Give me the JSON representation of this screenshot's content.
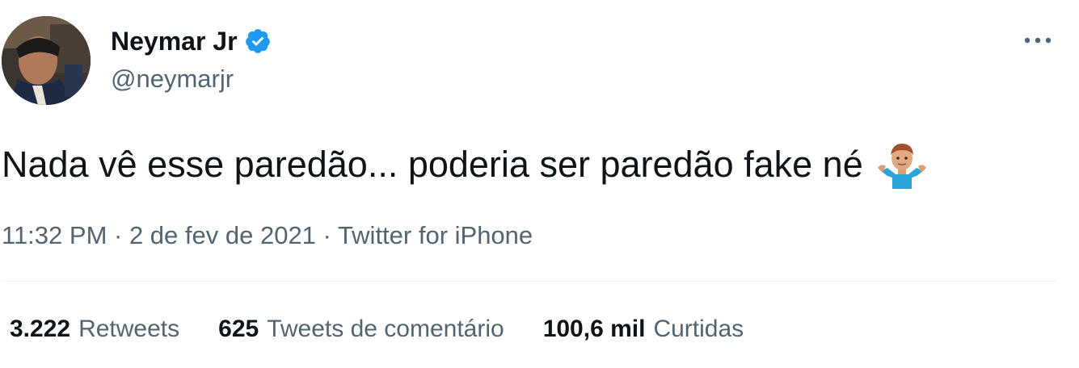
{
  "author": {
    "name": "Neymar Jr",
    "handle": "@neymarjr",
    "verified_color": "#1d9bf0"
  },
  "tweet": {
    "text": "Nada vê esse paredão... poderia ser paredão fake né",
    "emoji": "man-shrugging-emoji"
  },
  "meta": {
    "time": "11:32 PM",
    "sep1": " · ",
    "date": "2 de fev de 2021",
    "sep2": " · ",
    "source": "Twitter for iPhone"
  },
  "stats": {
    "retweets": {
      "count": "3.222",
      "label": "Retweets"
    },
    "quotes": {
      "count": "625",
      "label": "Tweets de comentário"
    },
    "likes": {
      "count": "100,6 mil",
      "label": "Curtidas"
    }
  },
  "colors": {
    "text": "#0f1419",
    "secondary": "#536471",
    "divider": "#eff3f4"
  }
}
